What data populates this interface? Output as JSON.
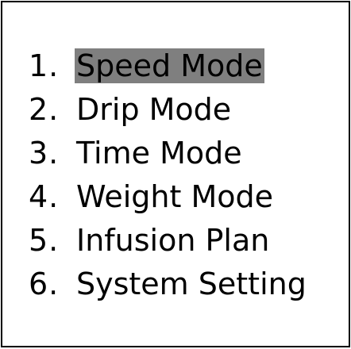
{
  "menu": {
    "selected_index": 0,
    "highlight_color": "#7f7f7f",
    "items": [
      {
        "number": "1.",
        "label": "Speed Mode"
      },
      {
        "number": "2.",
        "label": "Drip Mode"
      },
      {
        "number": "3.",
        "label": "Time Mode"
      },
      {
        "number": "4.",
        "label": "Weight Mode"
      },
      {
        "number": "5.",
        "label": "Infusion Plan"
      },
      {
        "number": "6.",
        "label": "System Setting"
      }
    ]
  }
}
